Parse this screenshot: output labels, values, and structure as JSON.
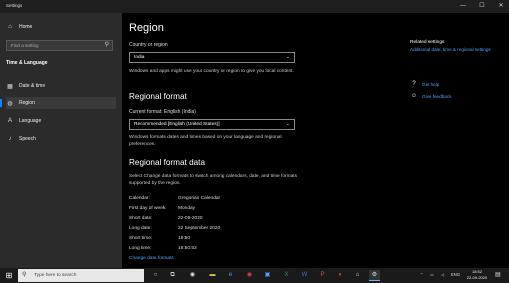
{
  "window": {
    "title": "Settings",
    "controls": {
      "minimize": "—",
      "maximize": "☐",
      "close": "✕"
    }
  },
  "sidebar": {
    "home_label": "Home",
    "search_placeholder": "Find a setting",
    "section_title": "Time & Language",
    "items": [
      {
        "label": "Date & time",
        "icon": "calendar-clock-icon"
      },
      {
        "label": "Region",
        "icon": "globe-icon",
        "active": true
      },
      {
        "label": "Language",
        "icon": "language-icon"
      },
      {
        "label": "Speech",
        "icon": "microphone-icon"
      }
    ]
  },
  "main": {
    "title": "Region",
    "country_label": "Country or region",
    "country_value": "India",
    "country_help": "Windows and apps might use your country or region to give you local content.",
    "regional_format_heading": "Regional format",
    "current_format_label": "Current format: English (India)",
    "format_value": "Recommended [English (United States)]",
    "format_help": "Windows formats dates and times based on your language and regional preferences.",
    "format_data_heading": "Regional format data",
    "format_data_help": "Select Change data formats to switch among calendars, date, and time formats supported by the region.",
    "rows": [
      {
        "key": "Calendar:",
        "value": "Gregorian Calendar"
      },
      {
        "key": "First day of week:",
        "value": "Monday"
      },
      {
        "key": "Short date:",
        "value": "22-09-2020"
      },
      {
        "key": "Long date:",
        "value": "22 September 2020"
      },
      {
        "key": "Short time:",
        "value": "18:50"
      },
      {
        "key": "Long time:",
        "value": "18:50:53"
      }
    ],
    "change_link": "Change data formats"
  },
  "related": {
    "title": "Related settings",
    "link": "Additional date, time & regional settings",
    "help": "Get help",
    "feedback": "Give feedback"
  },
  "taskbar": {
    "search_placeholder": "Type here to search",
    "apps": [
      "cortana-icon",
      "task-view-icon",
      "chrome-icon",
      "folder-icon",
      "edge-icon",
      "chrome-icon",
      "photos-icon",
      "excel-icon",
      "word-icon",
      "powerpoint-icon",
      "firefox-icon",
      "store-icon",
      "settings-icon"
    ],
    "tray_lang": "ENG",
    "time": "18:52",
    "date": "22-09-2020"
  },
  "colors": {
    "accent": "#4fa3ff",
    "background": "#000000",
    "sidebar": "#2b2b2b"
  }
}
